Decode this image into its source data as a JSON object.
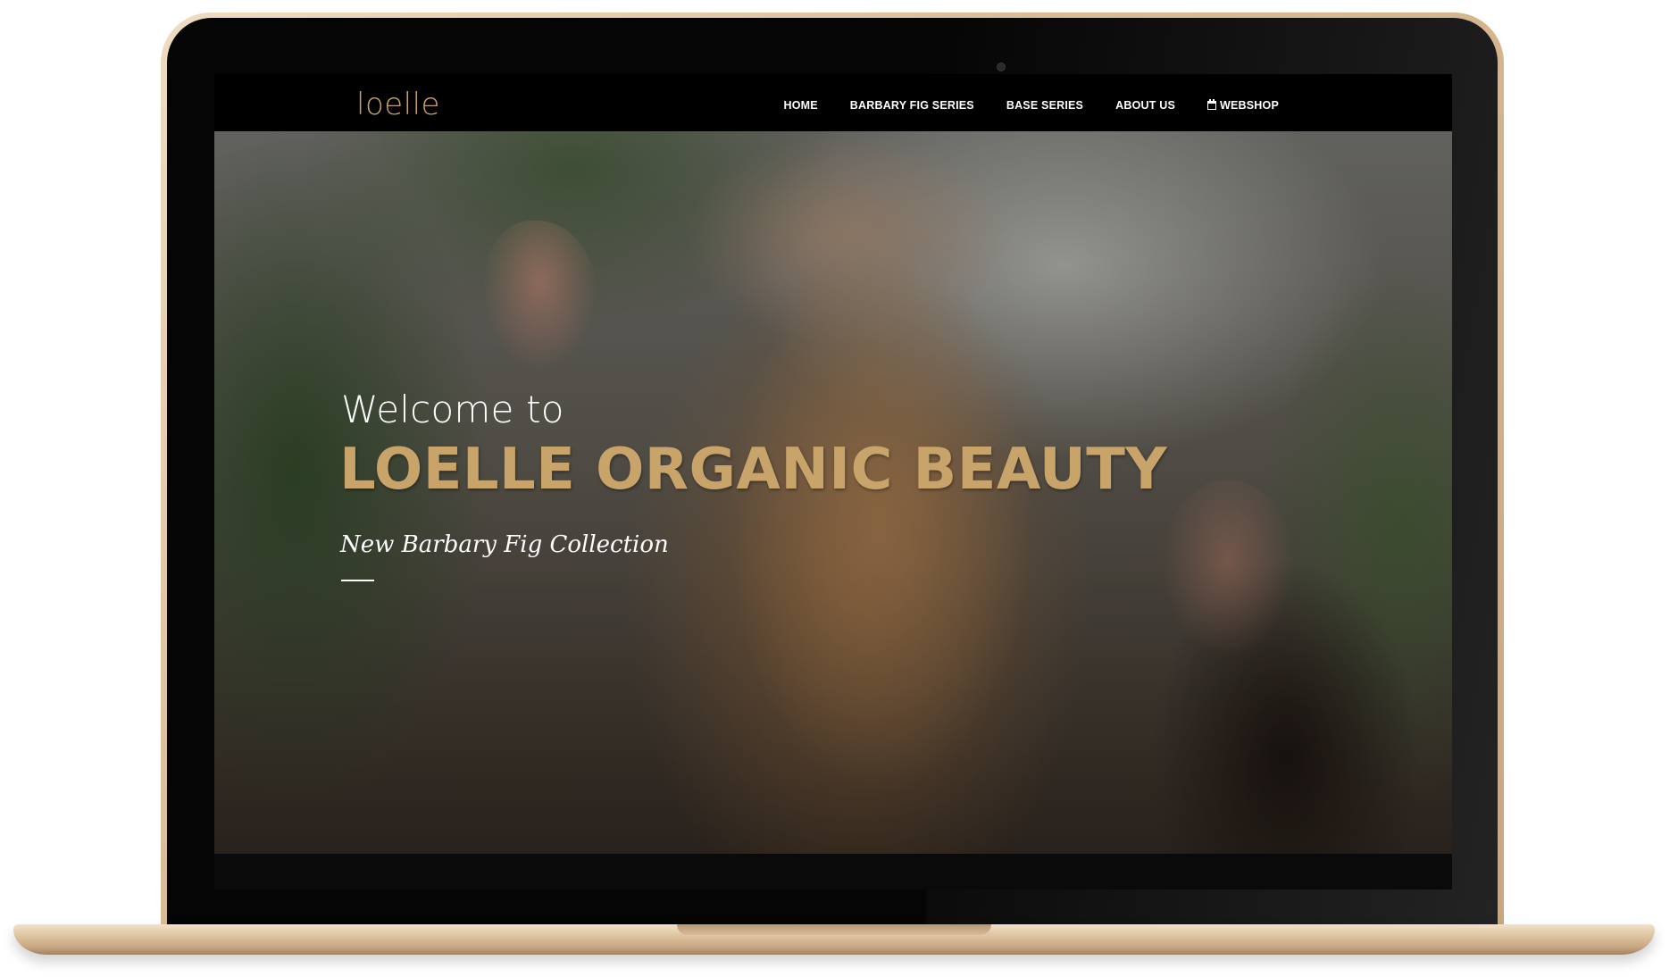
{
  "brand": {
    "logo_text": "loelle",
    "accent_color": "#c9a46a"
  },
  "nav": {
    "items": [
      {
        "label": "HOME"
      },
      {
        "label": "BARBARY FIG SERIES"
      },
      {
        "label": "BASE SERIES"
      },
      {
        "label": "ABOUT US"
      },
      {
        "label": "WEBSHOP",
        "icon": "calendar-icon"
      }
    ]
  },
  "hero": {
    "welcome": "Welcome to",
    "title": "LOELLE ORGANIC BEAUTY",
    "subtitle": "New Barbary Fig Collection"
  }
}
